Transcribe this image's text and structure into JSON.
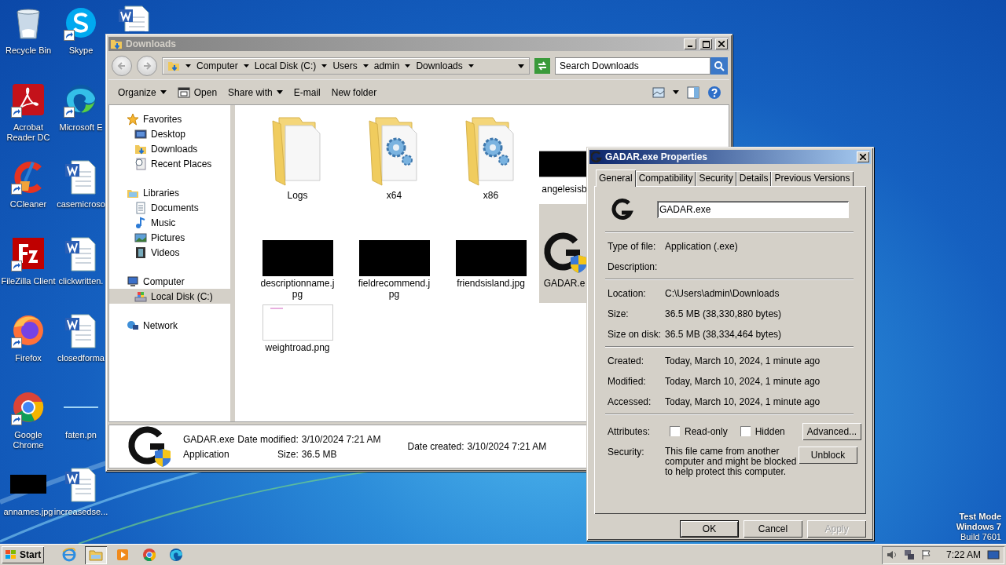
{
  "desktop": {
    "icons": [
      {
        "label": "Recycle Bin",
        "kind": "recycle",
        "shortcut": false
      },
      {
        "label": "Acrobat Reader DC",
        "kind": "acrobat",
        "shortcut": true
      },
      {
        "label": "CCleaner",
        "kind": "ccleaner",
        "shortcut": true
      },
      {
        "label": "FileZilla Client",
        "kind": "filezilla",
        "shortcut": true
      },
      {
        "label": "Firefox",
        "kind": "firefox",
        "shortcut": true
      },
      {
        "label": "Google Chrome",
        "kind": "chrome",
        "shortcut": true
      },
      {
        "label": "annames.jpg",
        "kind": "image-dark",
        "shortcut": false
      },
      {
        "label": "Skype",
        "kind": "skype",
        "shortcut": true
      },
      {
        "label": "Microsoft E",
        "kind": "edge",
        "shortcut": true
      },
      {
        "label": "casemicroso",
        "kind": "word",
        "shortcut": false
      },
      {
        "label": "clickwritten.",
        "kind": "word",
        "shortcut": false
      },
      {
        "label": "closedforma",
        "kind": "word",
        "shortcut": false
      },
      {
        "label": "faten.pn",
        "kind": "image-blank",
        "shortcut": false
      },
      {
        "label": "increasedse...",
        "kind": "word",
        "shortcut": false
      },
      {
        "kind": "word",
        "shortcut": false
      }
    ],
    "watermark": [
      "Test Mode",
      "Windows 7",
      "Build 7601"
    ]
  },
  "explorer": {
    "title": "Downloads",
    "breadcrumb": [
      "Computer",
      "Local Disk (C:)",
      "Users",
      "admin",
      "Downloads"
    ],
    "search": {
      "placeholder": "Search Downloads"
    },
    "toolbar": [
      {
        "label": "Organize",
        "kind": "plain",
        "dropdown": true
      },
      {
        "label": "Open",
        "kind": "open",
        "dropdown": false
      },
      {
        "label": "Share with",
        "kind": "plain",
        "dropdown": true
      },
      {
        "label": "E-mail",
        "kind": "plain",
        "dropdown": false
      },
      {
        "label": "New folder",
        "kind": "plain",
        "dropdown": false
      }
    ],
    "nav": [
      {
        "label": "Favorites",
        "kind": "star",
        "selected": false,
        "children": [
          {
            "label": "Desktop",
            "kind": "desktop",
            "selected": false
          },
          {
            "label": "Downloads",
            "kind": "downloads",
            "selected": false
          },
          {
            "label": "Recent Places",
            "kind": "recent",
            "selected": false
          }
        ]
      },
      {
        "label": "Libraries",
        "kind": "library",
        "selected": false,
        "children": [
          {
            "label": "Documents",
            "kind": "documents",
            "selected": false
          },
          {
            "label": "Music",
            "kind": "music",
            "selected": false
          },
          {
            "label": "Pictures",
            "kind": "pictures",
            "selected": false
          },
          {
            "label": "Videos",
            "kind": "videos",
            "selected": false
          }
        ]
      },
      {
        "label": "Computer",
        "kind": "computer",
        "selected": false,
        "children": [
          {
            "label": "Local Disk (C:)",
            "kind": "disk",
            "selected": true
          }
        ]
      },
      {
        "label": "Network",
        "kind": "network",
        "selected": false
      }
    ],
    "items": [
      {
        "label": "Logs",
        "kind": "folder",
        "selected": false
      },
      {
        "label": "x64",
        "kind": "folder-gear",
        "selected": false
      },
      {
        "label": "x86",
        "kind": "folder-gear",
        "selected": false
      },
      {
        "label": "angelesisb",
        "kind": "image-dark",
        "selected": false
      },
      {
        "label": "descriptionname.jpg",
        "kind": "image-dark",
        "selected": false
      },
      {
        "label": "fieldrecommend.jpg",
        "kind": "image-dark",
        "selected": false
      },
      {
        "label": "friendsisland.jpg",
        "kind": "image-dark",
        "selected": false
      },
      {
        "label": "GADAR.e",
        "kind": "app",
        "selected": true
      },
      {
        "label": "weightroad.png",
        "kind": "image-light",
        "selected": false
      }
    ],
    "details": {
      "name": "GADAR.exe",
      "type": "Application",
      "columns": [
        [
          {
            "label": "Date modified:",
            "value": "3/10/2024 7:21 AM"
          },
          {
            "label": "Size:",
            "value": "36.5 MB"
          }
        ],
        [
          {
            "label": "Date created:",
            "value": "3/10/2024 7:21 AM"
          }
        ]
      ]
    }
  },
  "dialog": {
    "title": "GADAR.exe Properties",
    "tabs": [
      {
        "label": "General",
        "selected": true
      },
      {
        "label": "Compatibility",
        "selected": false
      },
      {
        "label": "Security",
        "selected": false
      },
      {
        "label": "Details",
        "selected": false
      },
      {
        "label": "Previous Versions",
        "selected": false
      }
    ],
    "name_field": {
      "value": "GADAR.exe"
    },
    "sections": [
      [
        {
          "label": "Type of file:",
          "value": "Application (.exe)"
        },
        {
          "label": "Description:"
        }
      ],
      [
        {
          "label": "Location:",
          "value": "C:\\Users\\admin\\Downloads"
        },
        {
          "label": "Size:",
          "value": "36.5 MB (38,330,880 bytes)"
        },
        {
          "label": "Size on disk:",
          "value": "36.5 MB (38,334,464 bytes)"
        }
      ],
      [
        {
          "label": "Created:",
          "value": "Today, March 10, 2024, 1 minute ago"
        },
        {
          "label": "Modified:",
          "value": "Today, March 10, 2024, 1 minute ago"
        },
        {
          "label": "Accessed:",
          "value": "Today, March 10, 2024, 1 minute ago"
        }
      ]
    ],
    "attributes": {
      "label": "Attributes:",
      "checkboxes": [
        {
          "label": "Read-only",
          "checked": false
        },
        {
          "label": "Hidden",
          "checked": false
        }
      ],
      "button": "Advanced..."
    },
    "security": {
      "label": "Security:",
      "text": "This file came from another computer and might be blocked to help protect this computer.",
      "button": "Unblock"
    },
    "buttons": [
      {
        "label": "OK",
        "default": true,
        "disabled": false
      },
      {
        "label": "Cancel",
        "default": false,
        "disabled": false
      },
      {
        "label": "Apply",
        "default": false,
        "disabled": true
      }
    ]
  },
  "taskbar": {
    "start": "Start",
    "apps": [
      {
        "kind": "ie",
        "active": false
      },
      {
        "kind": "explorer",
        "active": true
      },
      {
        "kind": "media",
        "active": false
      },
      {
        "kind": "chrome",
        "active": false
      },
      {
        "kind": "edge",
        "active": false
      }
    ],
    "time": "7:22 AM"
  }
}
